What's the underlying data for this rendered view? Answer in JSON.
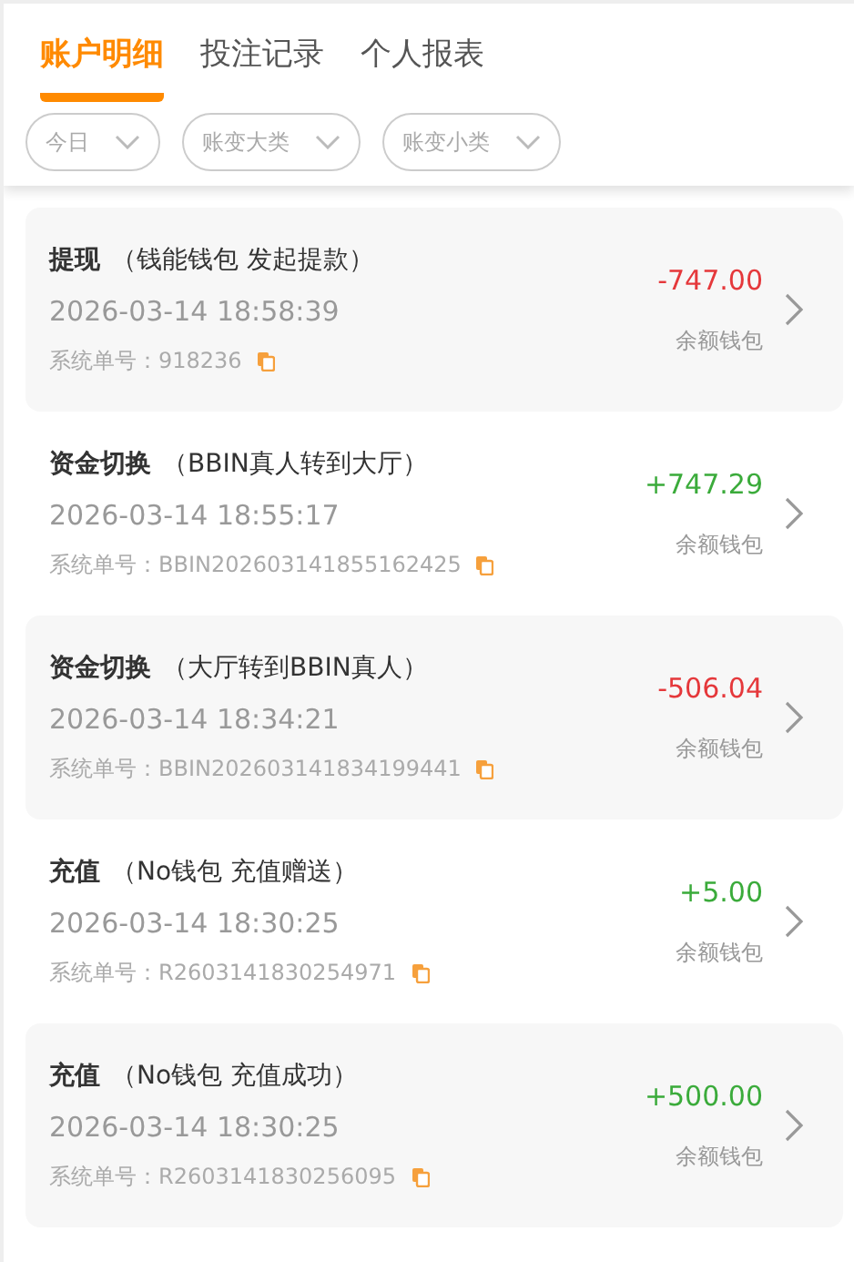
{
  "tabs": [
    {
      "label": "账户明细",
      "selected": true
    },
    {
      "label": "投注记录",
      "selected": false
    },
    {
      "label": "个人报表",
      "selected": false
    }
  ],
  "filters": [
    {
      "label": "今日"
    },
    {
      "label": "账变大类"
    },
    {
      "label": "账变小类"
    }
  ],
  "records": [
    {
      "type": "提现",
      "detail": "（钱能钱包 发起提款）",
      "time": "2026-03-14 18:58:39",
      "order_label": "系统单号：",
      "order_no": "918236",
      "amount": "-747.00",
      "color": "#e5383b",
      "wallet": "余额钱包"
    },
    {
      "type": "资金切换",
      "detail": "（BBIN真人转到大厅）",
      "time": "2026-03-14 18:55:17",
      "order_label": "系统单号：",
      "order_no": "BBIN202603141855162425",
      "amount": "+747.29",
      "color": "#3bab3b",
      "wallet": "余额钱包"
    },
    {
      "type": "资金切换",
      "detail": "（大厅转到BBIN真人）",
      "time": "2026-03-14 18:34:21",
      "order_label": "系统单号：",
      "order_no": "BBIN202603141834199441",
      "amount": "-506.04",
      "color": "#e5383b",
      "wallet": "余额钱包"
    },
    {
      "type": "充值",
      "detail": "（No钱包 充值赠送）",
      "time": "2026-03-14 18:30:25",
      "order_label": "系统单号：",
      "order_no": "R2603141830254971",
      "amount": "+5.00",
      "color": "#3bab3b",
      "wallet": "余额钱包"
    },
    {
      "type": "充值",
      "detail": "（No钱包 充值成功）",
      "time": "2026-03-14 18:30:25",
      "order_label": "系统单号：",
      "order_no": "R2603141830256095",
      "amount": "+500.00",
      "color": "#3bab3b",
      "wallet": "余额钱包"
    }
  ]
}
